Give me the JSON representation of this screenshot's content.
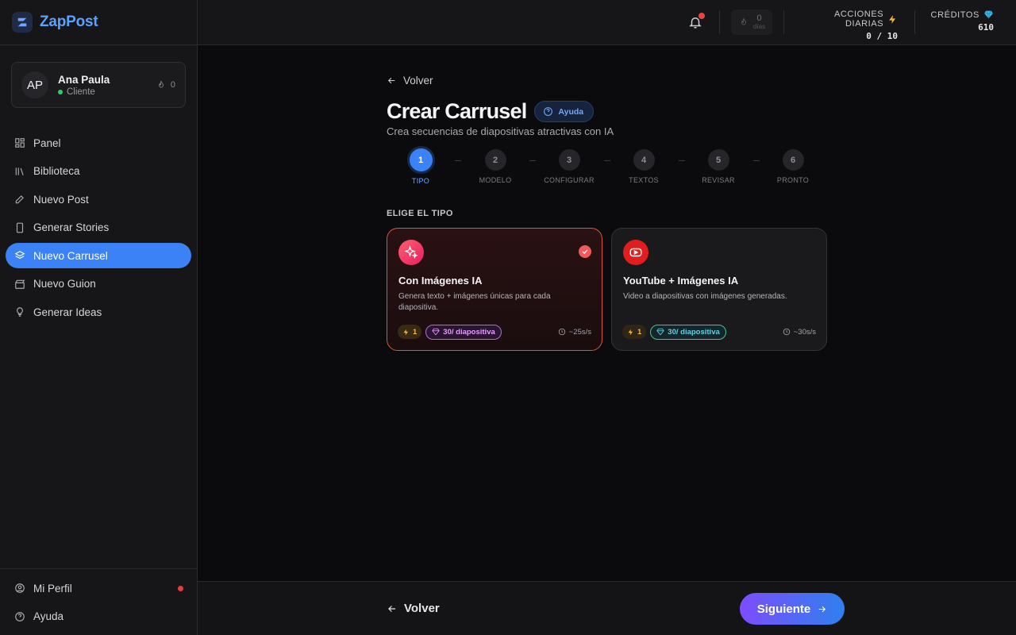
{
  "brand": {
    "name": "ZapPost",
    "logo_text": "ZapPost"
  },
  "user": {
    "initials": "AP",
    "name": "Ana Paula",
    "role": "Cliente",
    "streak": "0"
  },
  "nav": {
    "items": [
      {
        "label": "Panel",
        "icon": "grid-icon"
      },
      {
        "label": "Biblioteca",
        "icon": "library-icon"
      },
      {
        "label": "Nuevo Post",
        "icon": "pencil-icon"
      },
      {
        "label": "Generar Stories",
        "icon": "phone-icon"
      },
      {
        "label": "Nuevo Carrusel",
        "icon": "layers-icon",
        "active": true
      },
      {
        "label": "Nuevo Guion",
        "icon": "clapper-icon"
      },
      {
        "label": "Generar Ideas",
        "icon": "bulb-icon"
      }
    ],
    "bottom": [
      {
        "label": "Mi Perfil",
        "icon": "user-circle-icon",
        "notification": true
      },
      {
        "label": "Ayuda",
        "icon": "help-circle-icon"
      }
    ]
  },
  "topbar": {
    "streak": {
      "value": "0",
      "label": "días"
    },
    "daily_actions": {
      "label": "ACCIONES DIARIAS",
      "value": "0 / 10"
    },
    "credits": {
      "label": "CRÉDITOS",
      "value": "610"
    }
  },
  "main": {
    "back_label": "Volver",
    "title": "Crear Carrusel",
    "help_label": "Ayuda",
    "subtitle": "Crea secuencias de diapositivas atractivas con IA",
    "steps": [
      {
        "num": "1",
        "label": "TIPO",
        "active": true
      },
      {
        "num": "2",
        "label": "MODELO"
      },
      {
        "num": "3",
        "label": "CONFIGURAR"
      },
      {
        "num": "4",
        "label": "TEXTOS"
      },
      {
        "num": "5",
        "label": "REVISAR"
      },
      {
        "num": "6",
        "label": "PRONTO"
      }
    ],
    "section_label": "ELIGE EL TIPO",
    "cards": [
      {
        "title": "Con Imágenes IA",
        "desc": "Genera texto + imágenes únicas para cada diapositiva.",
        "actions": "1",
        "credits": "30/ diapositiva",
        "time": "~25s/s",
        "selected": true
      },
      {
        "title": "YouTube + Imágenes IA",
        "desc": "Video a diapositivas con imágenes generadas.",
        "actions": "1",
        "credits": "30/ diapositiva",
        "time": "~30s/s"
      }
    ]
  },
  "footer": {
    "back_label": "Volver",
    "next_label": "Siguiente"
  },
  "colors": {
    "accent": "#3b82f6",
    "selected_border": "#d9543f",
    "brand": "#5aa2ff"
  }
}
